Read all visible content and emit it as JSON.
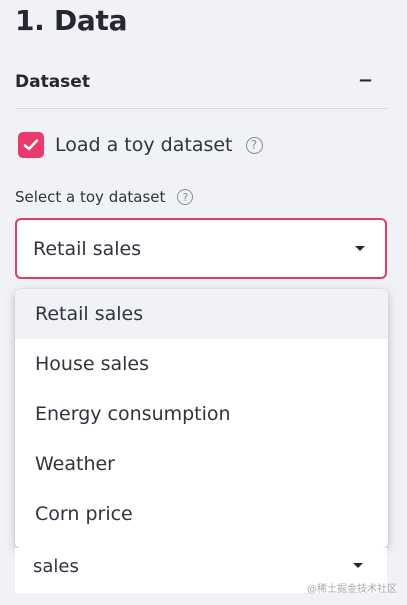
{
  "page": {
    "title": "1. Data"
  },
  "dataset_section": {
    "title": "Dataset",
    "collapse_symbol": "−"
  },
  "toy_dataset_checkbox": {
    "label": "Load a toy dataset",
    "checked": true,
    "help_symbol": "?"
  },
  "toy_dataset_select": {
    "label": "Select a toy dataset",
    "help_symbol": "?",
    "value": "Retail sales",
    "options": [
      "Retail sales",
      "House sales",
      "Energy consumption",
      "Weather",
      "Corn price"
    ],
    "highlighted_option": "Retail sales"
  },
  "partial_select": {
    "value": "sales"
  },
  "watermark": {
    "text": "@稀土掘金技术社区"
  },
  "colors": {
    "accent": "#ea3a6c",
    "select_border": "#e23a6b",
    "background": "#f0f2f6"
  },
  "icons": {
    "checkbox": "checkmark-icon",
    "help": "question-circle-icon",
    "caret": "chevron-down-icon"
  }
}
